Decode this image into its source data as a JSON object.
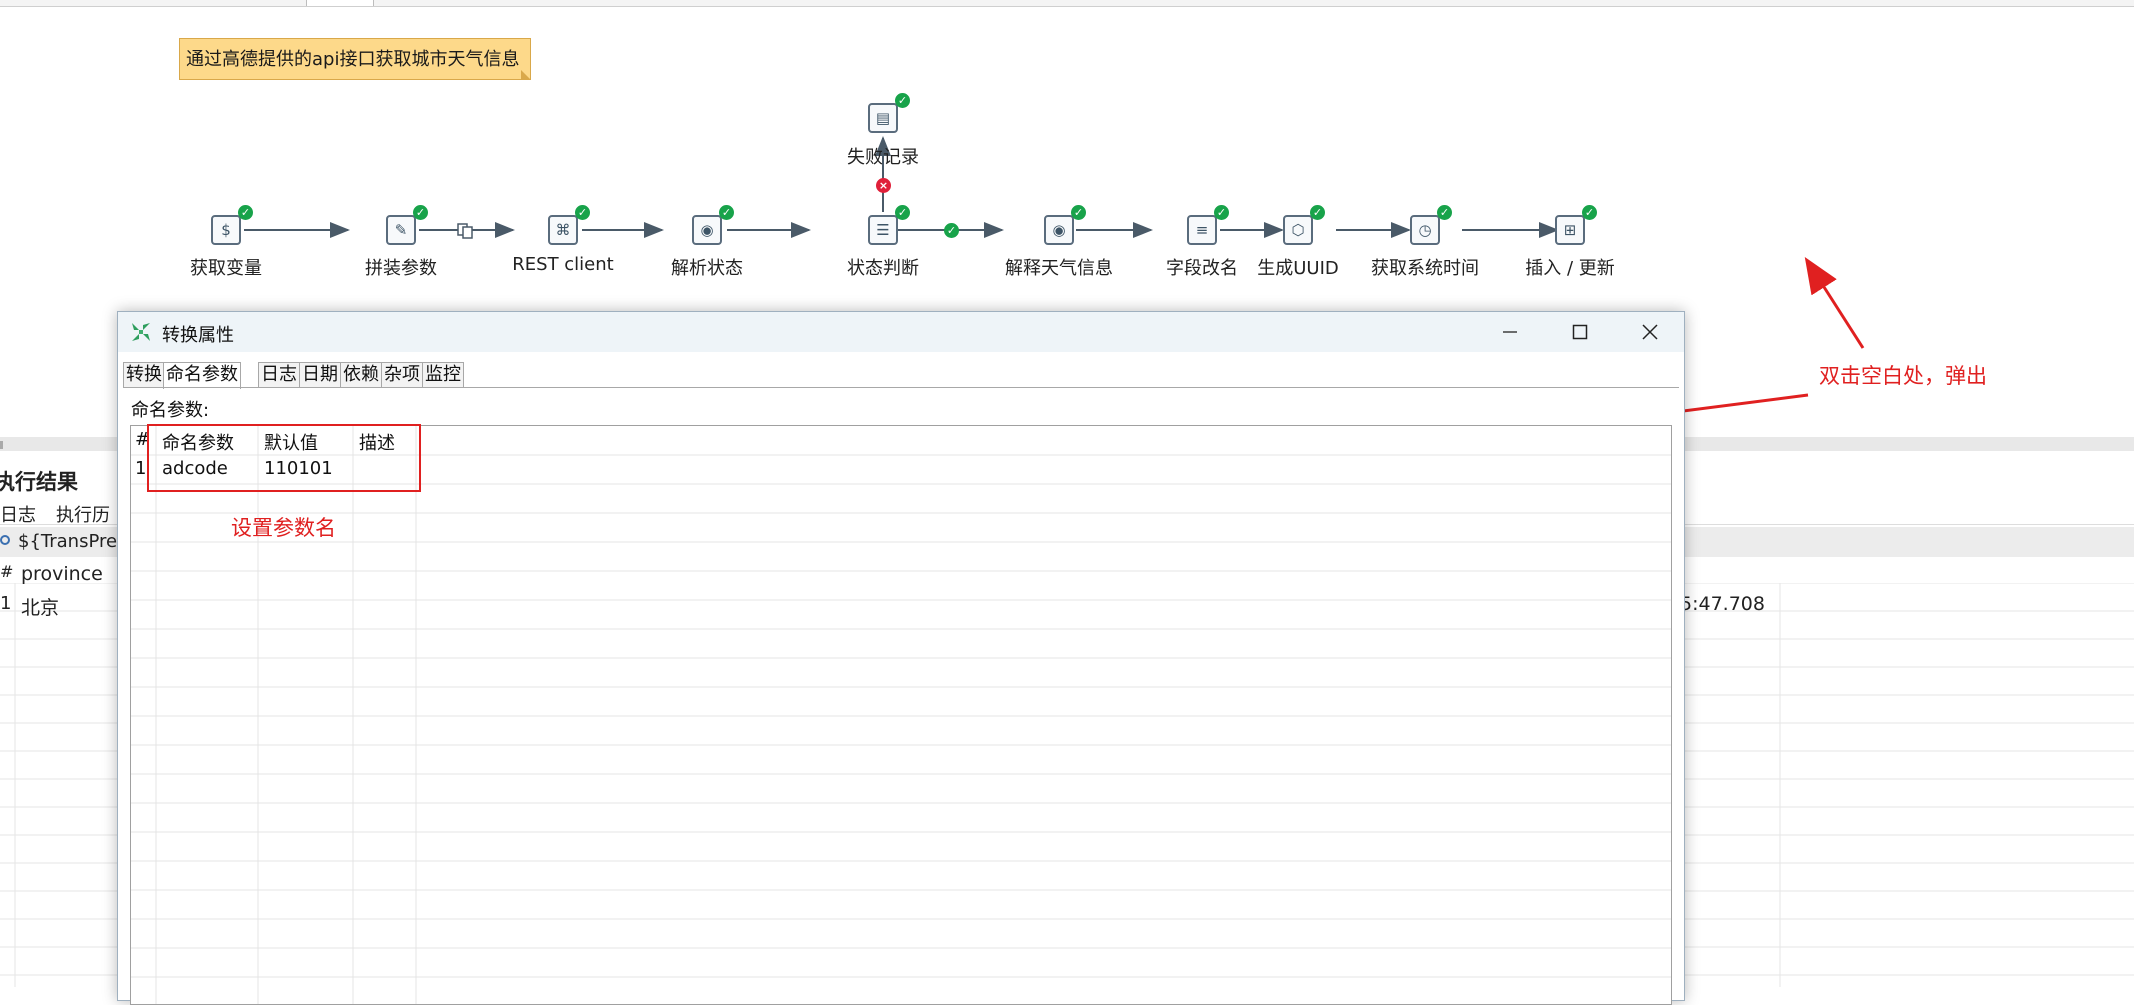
{
  "canvas": {
    "note_text": "通过高德提供的api接口获取城市天气信息",
    "steps": [
      {
        "label": "获取变量",
        "icon": "get-variables-icon"
      },
      {
        "label": "拼装参数",
        "icon": "script-icon"
      },
      {
        "label": "REST client",
        "icon": "rest-client-icon"
      },
      {
        "label": "解析状态",
        "icon": "json-input-icon"
      },
      {
        "label": "状态判断",
        "icon": "filter-rows-icon"
      },
      {
        "label": "解释天气信息",
        "icon": "json-input-icon"
      },
      {
        "label": "字段改名",
        "icon": "select-values-icon"
      },
      {
        "label": "生成UUID",
        "icon": "uuid-icon"
      },
      {
        "label": "获取系统时间",
        "icon": "system-info-icon"
      },
      {
        "label": "插入 / 更新",
        "icon": "insert-update-icon"
      }
    ],
    "error_step": {
      "label": "失败记录",
      "icon": "text-output-icon"
    },
    "status_icon": "check-icon",
    "error_hop_icon": "error-icon"
  },
  "annotations": {
    "popup_hint": "双击空白处，弹出",
    "param_hint": "设置参数名",
    "color": "#e02020"
  },
  "results_panel": {
    "title": "执行结果",
    "tabs": [
      "日志",
      "执行历"
    ],
    "preview_label": "${TransPrev",
    "column_hash": "#",
    "column_province": "province",
    "row": {
      "num": "1",
      "province": "北京",
      "time_fragment": "5:47.708"
    }
  },
  "dialog": {
    "title": "转换属性",
    "tabs": [
      "转换",
      "命名参数",
      "日志",
      "日期",
      "依赖",
      "杂项",
      "监控"
    ],
    "active_tab": "命名参数",
    "section_label": "命名参数:",
    "table": {
      "headers": [
        "#",
        "命名参数",
        "默认值",
        "描述"
      ],
      "rows": [
        {
          "num": "1",
          "name": "adcode",
          "default": "110101",
          "description": ""
        }
      ]
    },
    "controls": {
      "minimize": "minimize-icon",
      "maximize": "maximize-icon",
      "close": "close-icon"
    }
  }
}
